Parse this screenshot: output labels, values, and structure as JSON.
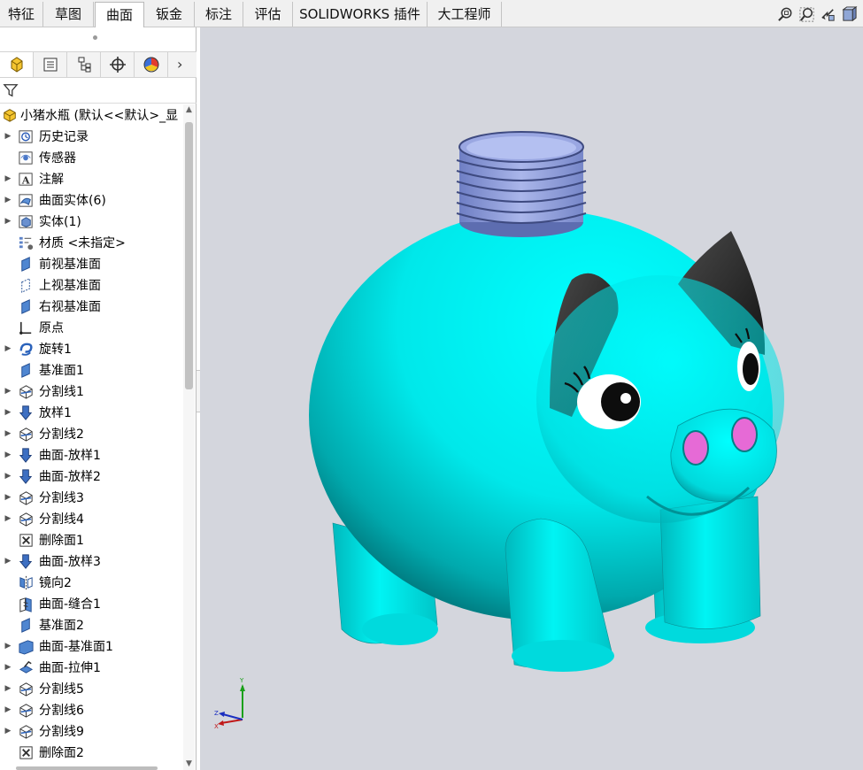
{
  "tabs": [
    "特征",
    "草图",
    "曲面",
    "钣金",
    "标注",
    "评估",
    "SOLIDWORKS 插件",
    "大工程师"
  ],
  "active_tab": "曲面",
  "view_tools": [
    "zoom-fit-icon",
    "zoom-area-icon",
    "previous-view-icon",
    "section-view-icon"
  ],
  "panel_tabs": [
    "feature-manager-icon",
    "property-manager-icon",
    "configuration-manager-icon",
    "dimxpert-icon",
    "display-manager-icon"
  ],
  "tree": {
    "root": "小猪水瓶  (默认<<默认>_显",
    "items": [
      {
        "label": "历史记录",
        "icon": "history-icon",
        "expandable": true
      },
      {
        "label": "传感器",
        "icon": "sensor-icon",
        "expandable": false
      },
      {
        "label": "注解",
        "icon": "annotation-icon",
        "expandable": true
      },
      {
        "label": "曲面实体(6)",
        "icon": "surface-bodies-icon",
        "expandable": true
      },
      {
        "label": "实体(1)",
        "icon": "solid-bodies-icon",
        "expandable": true
      },
      {
        "label": "材质 <未指定>",
        "icon": "material-icon",
        "expandable": false
      },
      {
        "label": "前视基准面",
        "icon": "plane-icon",
        "expandable": false
      },
      {
        "label": "上视基准面",
        "icon": "plane-outline-icon",
        "expandable": false
      },
      {
        "label": "右视基准面",
        "icon": "plane-icon",
        "expandable": false
      },
      {
        "label": "原点",
        "icon": "origin-icon",
        "expandable": false
      },
      {
        "label": "旋转1",
        "icon": "revolve-icon",
        "expandable": true
      },
      {
        "label": "基准面1",
        "icon": "plane-icon",
        "expandable": false
      },
      {
        "label": "分割线1",
        "icon": "split-line-icon",
        "expandable": true
      },
      {
        "label": "放样1",
        "icon": "loft-icon",
        "expandable": true
      },
      {
        "label": "分割线2",
        "icon": "split-line-icon",
        "expandable": true
      },
      {
        "label": "曲面-放样1",
        "icon": "loft-icon",
        "expandable": true
      },
      {
        "label": "曲面-放样2",
        "icon": "loft-icon",
        "expandable": true
      },
      {
        "label": "分割线3",
        "icon": "split-line-icon",
        "expandable": true
      },
      {
        "label": "分割线4",
        "icon": "split-line-icon",
        "expandable": true
      },
      {
        "label": "删除面1",
        "icon": "delete-face-icon",
        "expandable": false
      },
      {
        "label": "曲面-放样3",
        "icon": "loft-icon",
        "expandable": true
      },
      {
        "label": "镜向2",
        "icon": "mirror-icon",
        "expandable": false
      },
      {
        "label": "曲面-缝合1",
        "icon": "knit-icon",
        "expandable": false
      },
      {
        "label": "基准面2",
        "icon": "plane-icon",
        "expandable": false
      },
      {
        "label": "曲面-基准面1",
        "icon": "planar-surface-icon",
        "expandable": true
      },
      {
        "label": "曲面-拉伸1",
        "icon": "extrude-surface-icon",
        "expandable": true
      },
      {
        "label": "分割线5",
        "icon": "split-line-icon",
        "expandable": true
      },
      {
        "label": "分割线6",
        "icon": "split-line-icon",
        "expandable": true
      },
      {
        "label": "分割线9",
        "icon": "split-line-icon",
        "expandable": true
      },
      {
        "label": "删除面2",
        "icon": "delete-face-icon",
        "expandable": false
      }
    ]
  },
  "triad": {
    "x": "X",
    "y": "Y",
    "z": "Z"
  },
  "colors": {
    "body": "#00e5e5",
    "ears": "#2b2b2b",
    "nostrils": "#e66ad6",
    "neck": "#8c9bd8",
    "background": "#d4d6dd"
  }
}
